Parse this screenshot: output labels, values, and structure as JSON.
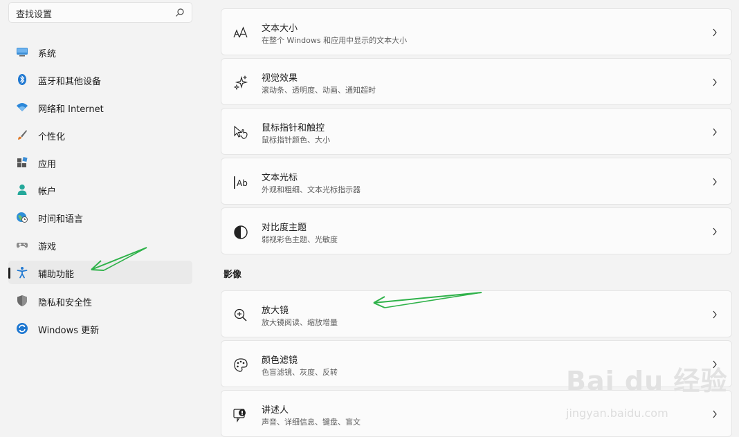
{
  "sidebar": {
    "search": {
      "placeholder": "查找设置"
    },
    "items": [
      {
        "label": "系统",
        "icon": "monitor-icon"
      },
      {
        "label": "蓝牙和其他设备",
        "icon": "bluetooth-icon"
      },
      {
        "label": "网络和 Internet",
        "icon": "wifi-icon"
      },
      {
        "label": "个性化",
        "icon": "brush-icon"
      },
      {
        "label": "应用",
        "icon": "apps-icon"
      },
      {
        "label": "帐户",
        "icon": "account-icon"
      },
      {
        "label": "时间和语言",
        "icon": "globe-clock-icon"
      },
      {
        "label": "游戏",
        "icon": "gamepad-icon"
      },
      {
        "label": "辅助功能",
        "icon": "accessibility-icon",
        "active": true
      },
      {
        "label": "隐私和安全性",
        "icon": "shield-icon"
      },
      {
        "label": "Windows 更新",
        "icon": "update-icon"
      }
    ]
  },
  "main": {
    "cards": [
      {
        "title": "文本大小",
        "desc": "在整个 Windows 和应用中显示的文本大小",
        "icon": "text-size-icon"
      },
      {
        "title": "视觉效果",
        "desc": "滚动条、透明度、动画、通知超时",
        "icon": "sparkle-icon"
      },
      {
        "title": "鼠标指针和触控",
        "desc": "鼠标指针颜色、大小",
        "icon": "pointer-icon"
      },
      {
        "title": "文本光标",
        "desc": "外观和粗细、文本光标指示器",
        "icon": "text-cursor-icon"
      },
      {
        "title": "对比度主题",
        "desc": "弱视彩色主题、光敏度",
        "icon": "contrast-icon"
      }
    ],
    "vision_section": {
      "header": "影像",
      "cards": [
        {
          "title": "放大镜",
          "desc": "放大镜阅读、缩放增量",
          "icon": "magnifier-icon"
        },
        {
          "title": "颜色滤镜",
          "desc": "色盲滤镜、灰度、反转",
          "icon": "palette-icon"
        },
        {
          "title": "讲述人",
          "desc": "声音、详细信息、键盘、盲文",
          "icon": "narrator-icon"
        }
      ]
    }
  },
  "watermark": {
    "logo": "Bai du 经验",
    "url": "jingyan.baidu.com"
  },
  "colors": {
    "accent": "#0067c0",
    "annotation_arrow": "#2fb24a",
    "background": "#f3f3f3",
    "card": "#fbfbfb"
  }
}
